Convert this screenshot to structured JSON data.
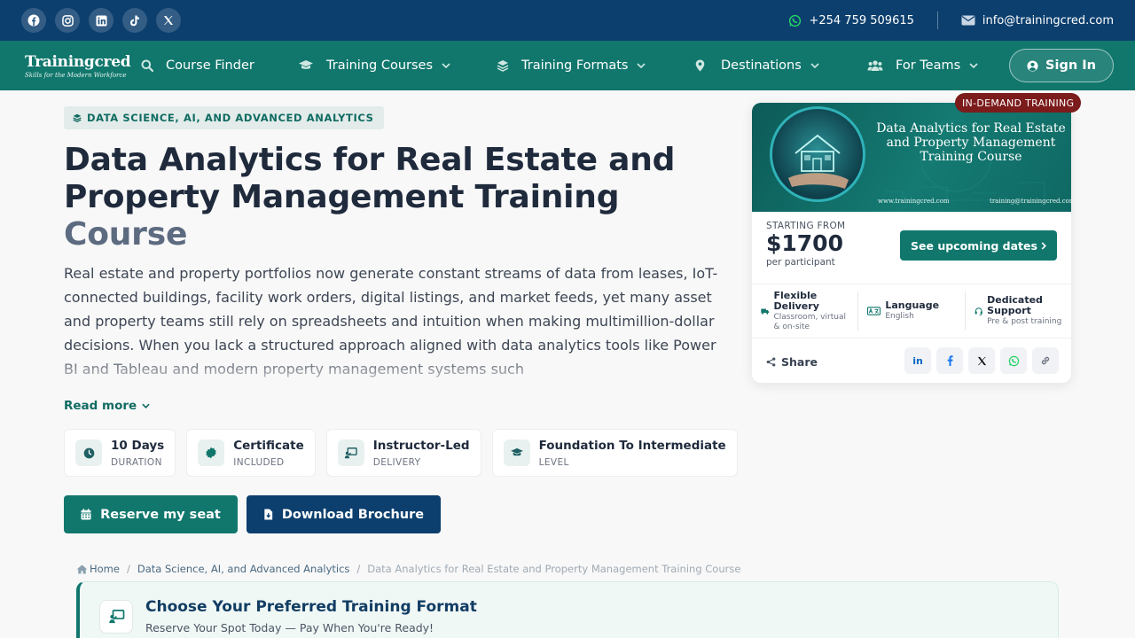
{
  "topbar": {
    "socials": [
      "facebook-icon",
      "instagram-icon",
      "linkedin-icon",
      "tiktok-icon",
      "x-icon"
    ],
    "phone": "+254 759 509615",
    "email": "info@trainingcred.com"
  },
  "nav": {
    "logo": "Trainingcred",
    "tagline": "Skills for the Modern Workforce",
    "items": [
      {
        "label": "Course Finder",
        "icon": "search-icon"
      },
      {
        "label": "Training Courses",
        "icon": "graduation-cap-icon"
      },
      {
        "label": "Training Formats",
        "icon": "layers-icon"
      },
      {
        "label": "Destinations",
        "icon": "location-pin-icon"
      },
      {
        "label": "For Teams",
        "icon": "team-icon"
      }
    ],
    "signin": "Sign In"
  },
  "course": {
    "category": "DATA SCIENCE, AI, AND ADVANCED ANALYTICS",
    "title_main": "Data Analytics for Real Estate and Property Management Training",
    "title_end": "Course",
    "description": "Real estate and property portfolios now generate constant streams of data from leases, IoT-connected buildings, facility work orders, digital listings, and market feeds, yet many asset and property teams still rely on spreadsheets and intuition when making multimillion-dollar decisions. When you lack a structured approach aligned with data analytics tools like Power BI and Tableau and modern property management systems such",
    "read_more": "Read more",
    "facts": [
      {
        "value": "10 Days",
        "label": "DURATION"
      },
      {
        "value": "Certificate",
        "label": "INCLUDED"
      },
      {
        "value": "Instructor-Led",
        "label": "DELIVERY"
      },
      {
        "value": "Foundation To Intermediate",
        "label": "LEVEL"
      }
    ],
    "reserve": "Reserve my seat",
    "brochure": "Download Brochure"
  },
  "breadcrumb": {
    "home": "Home",
    "category": "Data Science, AI, and Advanced Analytics",
    "current": "Data Analytics for Real Estate and Property Management Training Course"
  },
  "format": {
    "title": "Choose Your Preferred Training Format",
    "subtitle": "Reserve Your Spot Today — Pay When You're Ready!"
  },
  "card": {
    "tag": "IN-DEMAND TRAINING",
    "banner_title": "Data Analytics for Real Estate and Property Management Training Course",
    "banner_url": "www.trainingcred.com",
    "banner_email": "training@trainingcred.com",
    "price_label": "STARTING FROM",
    "price": "$1700",
    "price_unit": "per participant",
    "dates_button": "See upcoming dates",
    "features": [
      {
        "title": "Flexible Delivery",
        "desc": "Classroom, virtual & on-site"
      },
      {
        "title": "Language",
        "desc": "English"
      },
      {
        "title": "Dedicated Support",
        "desc": "Pre & post training"
      }
    ],
    "share": "Share"
  },
  "colors": {
    "topbar": "#0c3f6e",
    "nav": "#11776d",
    "accent": "#11776d",
    "navy": "#0c3f6e",
    "tag": "#7c1b1b"
  }
}
